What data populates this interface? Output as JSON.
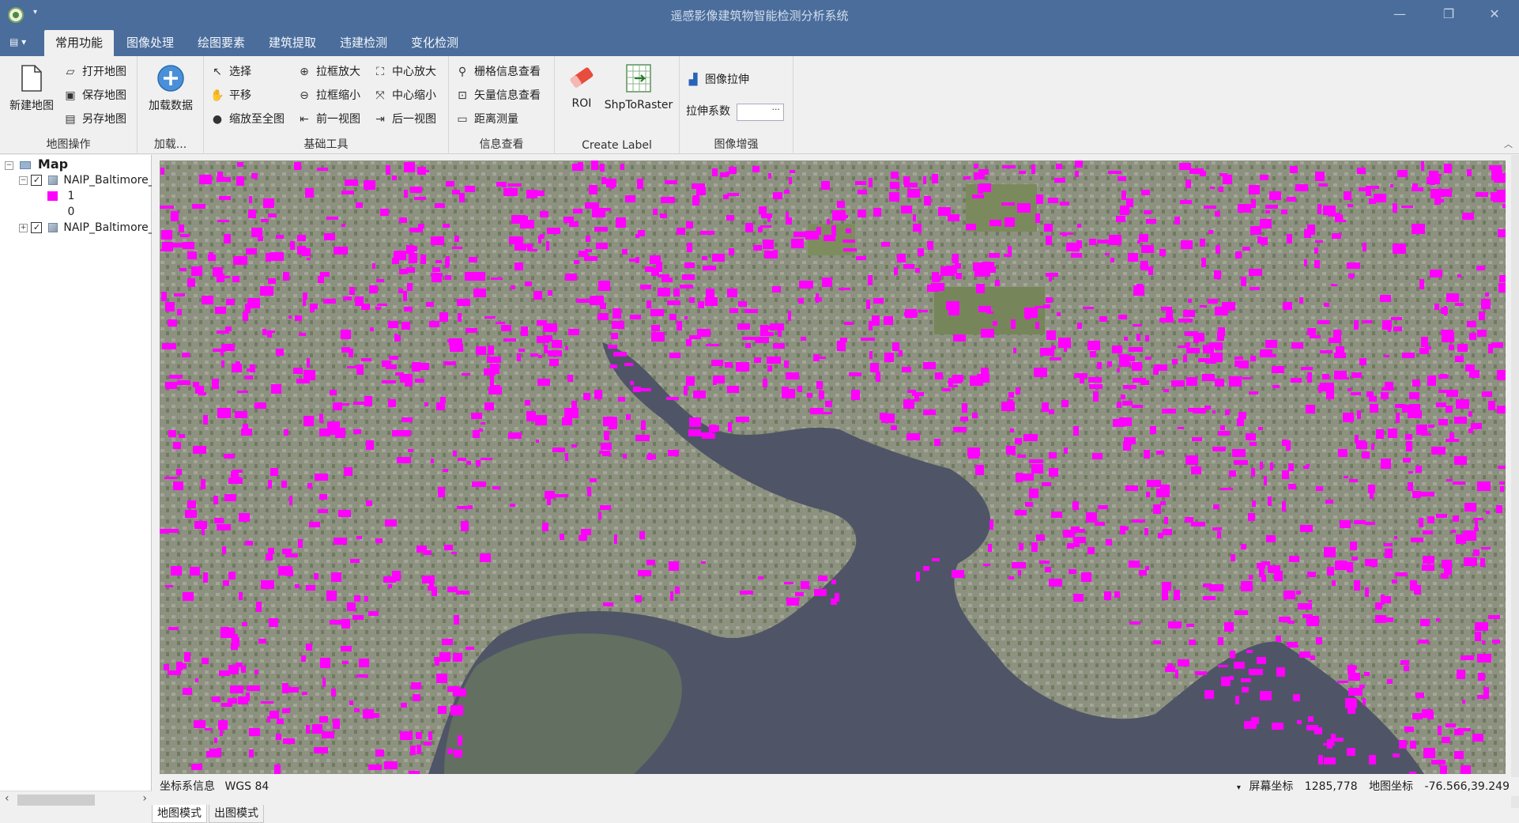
{
  "window": {
    "title": "遥感影像建筑物智能检测分析系统",
    "controls": [
      "—",
      "❐",
      "✕"
    ]
  },
  "ribbon": {
    "tabs": [
      "常用功能",
      "图像处理",
      "绘图要素",
      "建筑提取",
      "违建检测",
      "变化检测"
    ],
    "active_tab": "常用功能",
    "groups": {
      "map_ops": {
        "label": "地图操作",
        "new_map": "新建地图",
        "open_map": "打开地图",
        "save_map": "保存地图",
        "save_as": "另存地图"
      },
      "load": {
        "label": "加载...",
        "load_data": "加载数据"
      },
      "basic_tools": {
        "label": "基础工具",
        "select": "选择",
        "pan": "平移",
        "zoom_full": "缩放至全图",
        "box_zoom_in": "拉框放大",
        "box_zoom_out": "拉框缩小",
        "prev_view": "前一视图",
        "center_zoom_in": "中心放大",
        "center_zoom_out": "中心缩小",
        "next_view": "后一视图"
      },
      "info": {
        "label": "信息查看",
        "raster_info": "栅格信息查看",
        "vector_info": "矢量信息查看",
        "distance": "距离测量"
      },
      "create_label": {
        "label": "Create Label",
        "roi": "ROI",
        "shp_to_raster": "ShpToRaster"
      },
      "enhance": {
        "label": "图像增强",
        "stretch": "图像拉伸",
        "stretch_factor": "拉伸系数",
        "stretch_value": "",
        "stretch_btn": "···"
      }
    }
  },
  "toc": {
    "root": "Map",
    "layers": [
      {
        "name": "NAIP_Baltimore_",
        "checked": true,
        "expanded": true,
        "legend": [
          {
            "label": "1",
            "color": "#ff00ff"
          },
          {
            "label": "0",
            "color": ""
          }
        ]
      },
      {
        "name": "NAIP_Baltimore_",
        "checked": true,
        "expanded": false
      }
    ]
  },
  "status": {
    "crs_label": "坐标系信息",
    "crs_value": "WGS 84",
    "screen_label": "屏幕坐标",
    "screen_value": "1285,778",
    "map_label": "地图坐标",
    "map_value": "-76.566,39.249"
  },
  "mode_tabs": [
    "地图模式",
    "出图模式"
  ],
  "colors": {
    "titlebar": "#4a6d9c",
    "building_mask": "#ff00ff",
    "water": "#4f5566"
  }
}
